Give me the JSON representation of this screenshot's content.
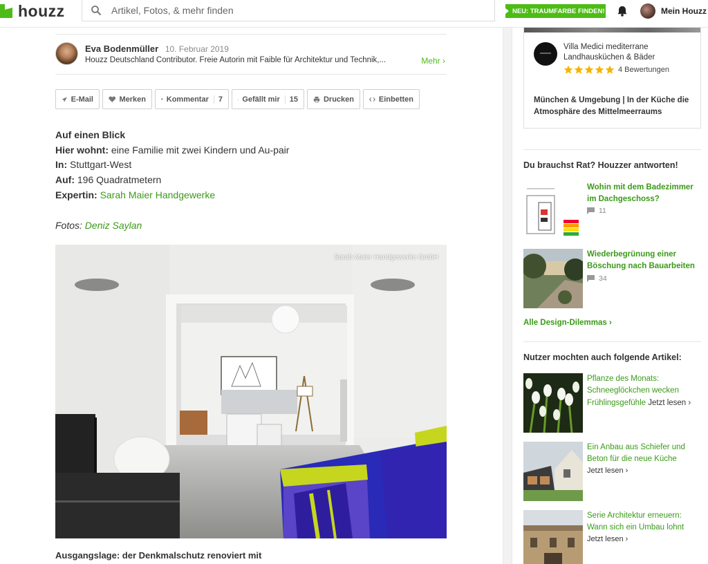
{
  "header": {
    "logo_text": "houzz",
    "search_placeholder": "Artikel, Fotos, & mehr finden",
    "promo_label": "NEU: TRAUMFARBE FINDEN!",
    "user_label": "Mein Houzz"
  },
  "author": {
    "name": "Eva Bodenmüller",
    "date": "10. Februar 2019",
    "bio": "Houzz Deutschland Contributor. Freie Autorin mit Faible für Architektur und Technik,...",
    "more_label": "Mehr"
  },
  "actions": {
    "email": "E-Mail",
    "save": "Merken",
    "comment": "Kommentar",
    "comment_count": "7",
    "like": "Gefällt mir",
    "like_count": "15",
    "print": "Drucken",
    "embed": "Einbetten"
  },
  "facts": {
    "heading": "Auf einen Blick",
    "who_label": "Hier wohnt:",
    "who_value": "eine Familie mit zwei Kindern und Au-pair",
    "where_label": "In:",
    "where_value": "Stuttgart-West",
    "size_label": "Auf:",
    "size_value": "196 Quadratmetern",
    "expert_label": "Expertin:",
    "expert_value": "Sarah Maier Handgewerke",
    "photos_label": "Fotos:",
    "photos_value": "Deniz Saylan"
  },
  "photo": {
    "credit": "Sarah Maier Handgewerke GmbH"
  },
  "next_heading": "Ausgangslage: der Denkmalschutz renoviert mit",
  "sidebar": {
    "pro": {
      "name": "Villa Medici mediterrane Landhausküchen & Bäder",
      "rating_value": 5,
      "reviews": "4 Bewertungen",
      "description": "München & Umgebung | In der Küche die Atmosphäre des Mittelmeerraums"
    },
    "questions_heading": "Du brauchst Rat? Houzzer antworten!",
    "questions": [
      {
        "title": "Wohin mit dem Badezimmer im Dachgeschoss?",
        "count": "11"
      },
      {
        "title": "Wiederbegrünung einer Böschung nach Bauarbeiten",
        "count": "34"
      }
    ],
    "all_link": "Alle Design-Dilemmas",
    "articles_heading": "Nutzer mochten auch folgende Artikel:",
    "articles": [
      {
        "title": "Pflanze des Monats: Schneeglöckchen wecken Frühlingsgefühle",
        "read": "Jetzt lesen"
      },
      {
        "title": "Ein Anbau aus Schiefer und Beton für die neue Küche",
        "read": "Jetzt lesen"
      },
      {
        "title": "Serie Architektur erneuern: Wann sich ein Umbau lohnt",
        "read": "Jetzt lesen"
      }
    ]
  },
  "colors": {
    "brand_green": "#4dbc15",
    "link_green": "#3b9a18",
    "star": "#f5b400"
  }
}
